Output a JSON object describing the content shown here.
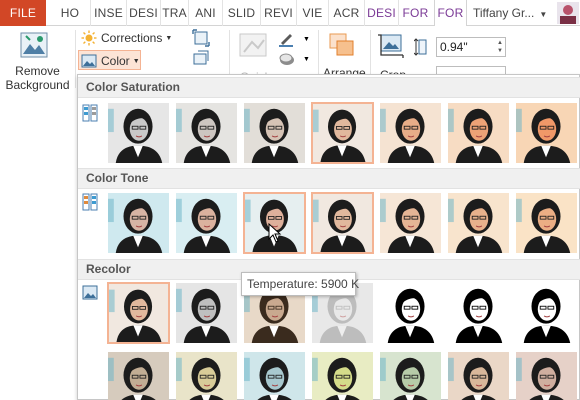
{
  "tabs": [
    {
      "label": "FILE",
      "type": "file"
    },
    {
      "label": "HO",
      "type": "normal"
    },
    {
      "label": "INSE",
      "type": "normal"
    },
    {
      "label": "DESI",
      "type": "normal"
    },
    {
      "label": "TRA",
      "type": "normal"
    },
    {
      "label": "ANI",
      "type": "normal"
    },
    {
      "label": "SLID",
      "type": "normal"
    },
    {
      "label": "REVI",
      "type": "normal"
    },
    {
      "label": "VIE",
      "type": "normal"
    },
    {
      "label": "ACR",
      "type": "normal"
    },
    {
      "label": "DESI",
      "type": "contextual"
    },
    {
      "label": "FOR",
      "type": "contextual"
    },
    {
      "label": "FOR",
      "type": "active"
    }
  ],
  "user": {
    "name": "Tiffany Gr..."
  },
  "ribbon": {
    "remove_background": "Remove\nBackground",
    "corrections": "Corrections",
    "color": "Color",
    "quick_styles": "Quick",
    "arrange": "Arrange",
    "crop": "Crop",
    "height_value": "0.94\""
  },
  "gallery": {
    "sections": [
      {
        "title": "Color Saturation"
      },
      {
        "title": "Color Tone"
      },
      {
        "title": "Recolor"
      }
    ],
    "rows": [
      {
        "tints": [
          "#e6e6e6",
          "#e5e4e1",
          "#e2ded8",
          "#f1e8e0",
          "#f5e3d2",
          "#f7dcc3",
          "#f8d6b5"
        ],
        "skins": [
          "#c9c9c9",
          "#cdc6c1",
          "#d6c3b5",
          "#e1b89d",
          "#e8ad88",
          "#eda276",
          "#f09868"
        ],
        "tones": [
          "gray",
          "desat",
          "mid",
          "normal",
          "warm",
          "warm",
          "warm"
        ]
      },
      {
        "tints": [
          "#cfe9ef",
          "#d9eef2",
          "#e6eff0",
          "#f1e8e0",
          "#f6e6d6",
          "#f8e4cd",
          "#fae3c6"
        ],
        "skins": [
          "#d7b4a4",
          "#dbb29e",
          "#deb09b",
          "#e1b89d",
          "#e5b595",
          "#e8b18c",
          "#ebae84"
        ],
        "tones": [
          "cool",
          "cool",
          "mid",
          "normal",
          "warm",
          "warm",
          "warm"
        ]
      },
      {
        "tints": [
          "#f1e8e0",
          "#e5e5e5",
          "#e8d9c8",
          "#e8e8e8",
          "#ffffff",
          "#ffffff",
          "#ffffff"
        ],
        "skins": [
          "#e1b89d",
          "#bfbfbf",
          "#c9a98f",
          "#e8e8e8",
          "#ffffff",
          "#ffffff",
          "#ffffff"
        ],
        "tones": [
          "normal",
          "gray",
          "sepia",
          "washout",
          "bw1",
          "bw2",
          "bw3"
        ]
      },
      {
        "tints": [
          "#d6cbbd",
          "#e9e4c9",
          "#cfe6ea",
          "#e8ecc3",
          "#d7e4cf",
          "#ead7c7",
          "#e6d1c8"
        ],
        "skins": [
          "#c2ad94",
          "#d8cc98",
          "#a8c9cf",
          "#d5dc8a",
          "#b6cba8",
          "#d8b79a",
          "#cfae9f"
        ],
        "tones": [
          "duo",
          "duo",
          "duo",
          "duo",
          "duo",
          "duo",
          "duo"
        ]
      }
    ],
    "tooltip": "Temperature: 5900 K"
  }
}
